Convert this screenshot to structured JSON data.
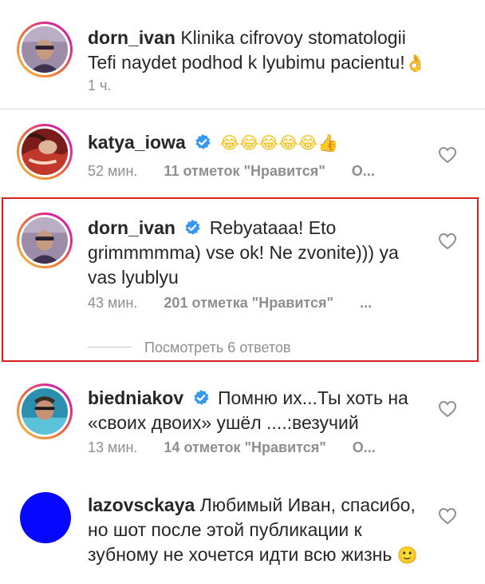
{
  "comments": [
    {
      "username": "dorn_ivan",
      "verified": false,
      "text": "Klinika cifrovoy stomatologii Tefi naydet podhod k lyubimu pacientu!",
      "emoji": "👌",
      "time": "1 ч.",
      "likes": "",
      "reply": "",
      "avatar": "dorn-ivan-photo"
    },
    {
      "username": "katya_iowa",
      "verified": true,
      "text": "",
      "emoji": "😂😂😂😂😂👍",
      "time": "52 мин.",
      "likes": "11 отметок \"Нравится\"",
      "reply": "О...",
      "avatar": "katya-iowa-photo"
    },
    {
      "username": "dorn_ivan",
      "verified": true,
      "text": "Rebyataaa! Eto grimmmmma) vse ok! Ne zvonite))) ya vas lyublyu",
      "emoji": "",
      "time": "43 мин.",
      "likes": "201 отметка \"Нравится\"",
      "reply": "...",
      "view_replies": "Посмотреть 6 ответов",
      "avatar": "dorn-ivan-photo"
    },
    {
      "username": "biedniakov",
      "verified": true,
      "text": "Помню их...Ты хоть на «своих двоих» ушёл ....:везучий",
      "emoji": "",
      "time": "13 мин.",
      "likes": "14 отметок \"Нравится\"",
      "reply": "О...",
      "avatar": "biedniakov-photo"
    },
    {
      "username": "lazovsckaya",
      "verified": false,
      "text": "Любимый Иван, спасибо, но шот после этой публикации к зубному не хочется идти всю жизнь",
      "emoji": "🙂",
      "time": "",
      "likes": "",
      "reply": "",
      "avatar": "blue-circle"
    }
  ],
  "colors": {
    "highlight_border": "#d81f1f",
    "verified_badge": "#3897f0",
    "avatar_placeholder": "#0707ff",
    "meta_text": "#8e8e8e"
  },
  "icons": [
    "heart-icon",
    "verified-badge-icon"
  ]
}
